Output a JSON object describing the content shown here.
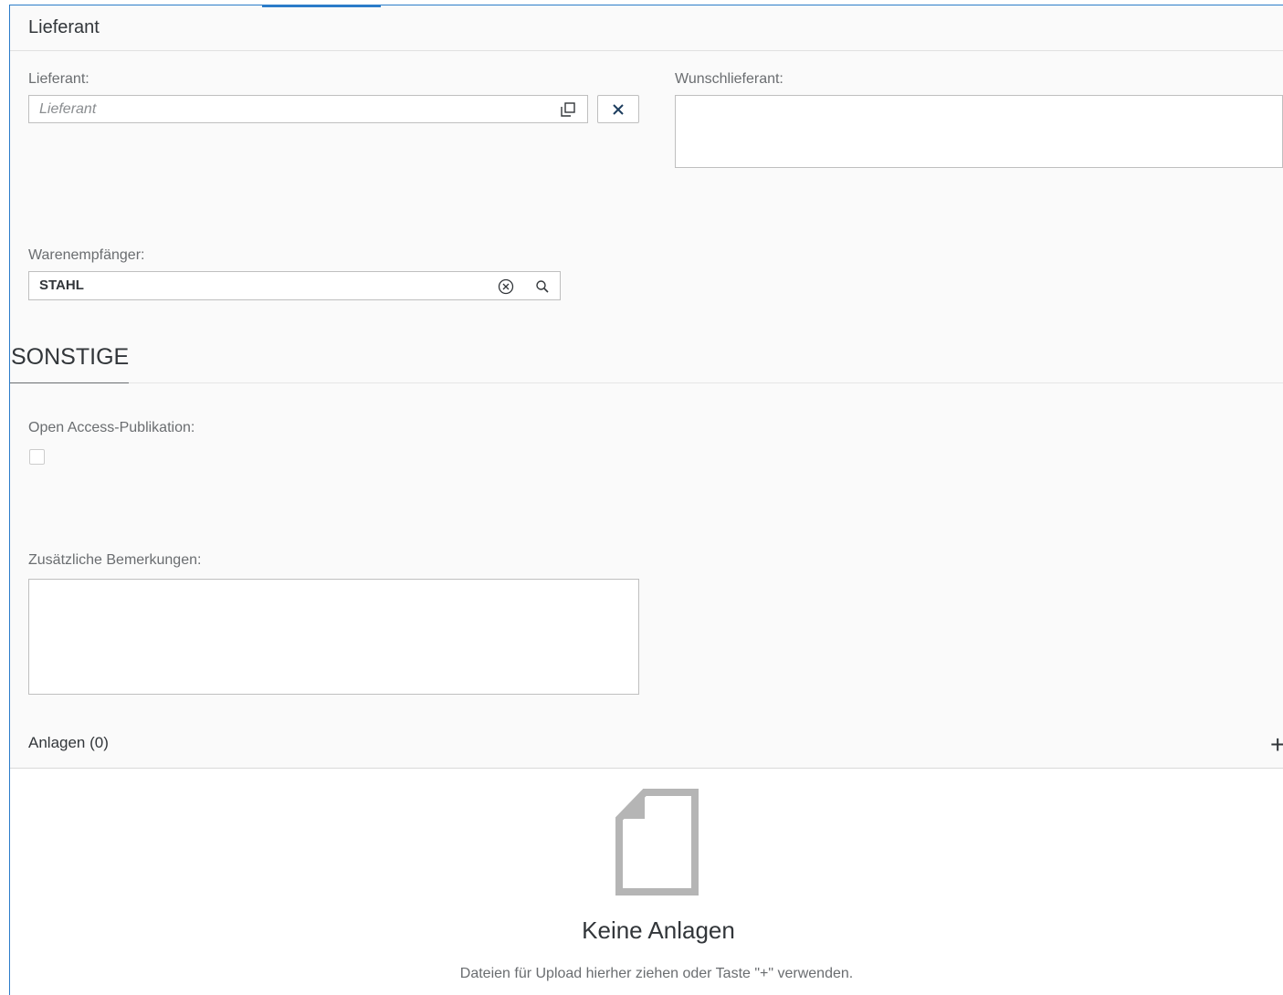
{
  "supplier_section": {
    "header": "Lieferant",
    "supplier_label": "Lieferant:",
    "supplier_placeholder": "Lieferant",
    "preferred_label": "Wunschlieferant:",
    "recipient_label": "Warenempfänger:",
    "recipient_value": "STAHL"
  },
  "other_section": {
    "header": "SONSTIGE",
    "open_access_label": "Open Access-Publikation:",
    "open_access_checked": false,
    "remarks_label": "Zusätzliche Bemerkungen:"
  },
  "attachments": {
    "title": "Anlagen (0)",
    "add_label": "+",
    "empty_title": "Keine Anlagen",
    "empty_text": "Dateien für Upload hierher ziehen oder Taste \"+\" verwenden."
  },
  "icons": {
    "value_help": "value-help-icon",
    "clear": "close-icon",
    "clear_circle": "clear-circle-icon",
    "search": "search-icon",
    "document": "document-icon"
  },
  "colors": {
    "accent": "#2b7cc9",
    "border": "#bfbfbf",
    "label": "#6a6d70"
  }
}
